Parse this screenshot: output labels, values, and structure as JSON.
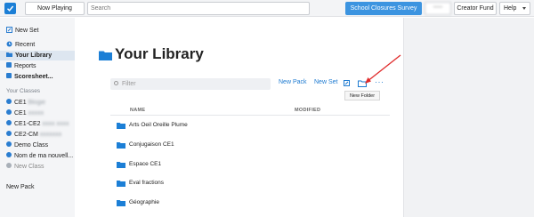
{
  "topbar": {
    "now_playing": "Now Playing",
    "search_placeholder": "Search",
    "survey": "School Closures Survey",
    "user": "•••••",
    "creator_fund": "Creator Fund",
    "help": "Help"
  },
  "sidebar": {
    "new_set": "New Set",
    "items": [
      {
        "label": "Recent"
      },
      {
        "label": "Your Library"
      },
      {
        "label": "Reports"
      },
      {
        "label": "Scoresheet..."
      }
    ],
    "classes_label": "Your Classes",
    "classes": [
      {
        "label": "CE1",
        "blurred": "Blogie"
      },
      {
        "label": "CE1",
        "blurred": "xxxxx"
      },
      {
        "label": "CE1-CE2",
        "blurred": "xxxx xxxx"
      },
      {
        "label": "CE2-CM",
        "blurred": "xxxxxxx"
      },
      {
        "label": "Demo Class"
      },
      {
        "label": "Nom de ma nouvell..."
      },
      {
        "label": "New Class"
      }
    ],
    "new_pack": "New Pack"
  },
  "main": {
    "title": "Your Library",
    "filter_placeholder": "Filter",
    "new_pack": "New Pack",
    "new_set": "New Set",
    "more": "···",
    "tooltip": "New Folder",
    "col_name": "NAME",
    "col_modified": "MODIFIED",
    "folders": [
      "Arts Oeil Oreille Plume",
      "Conjugaison CE1",
      "Espace CE1",
      "Eval fractions",
      "Géographie"
    ]
  },
  "colors": {
    "accent": "#1e7bd1",
    "survey_bg": "#3c94e0",
    "annotation_arrow": "#e02a2a"
  }
}
